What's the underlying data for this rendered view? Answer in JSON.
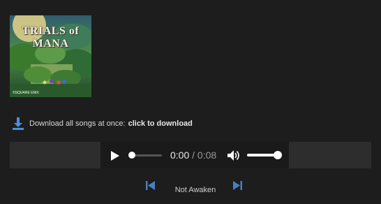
{
  "album": {
    "cover_title": "TRIALS of MANA",
    "cover_copyright": "©SQUARE ENIX"
  },
  "download": {
    "icon": "download-arrow-icon",
    "prefix": "Download all songs at once:",
    "link_label": "click to download",
    "accent": "#4a90d9"
  },
  "player": {
    "current_time": "0:00",
    "separator": " / ",
    "duration": "0:08",
    "progress": 0,
    "volume": 1
  },
  "track_nav": {
    "previous_icon": "skip-previous-icon",
    "next_icon": "skip-next-icon",
    "current_song": "Not Awaken"
  }
}
